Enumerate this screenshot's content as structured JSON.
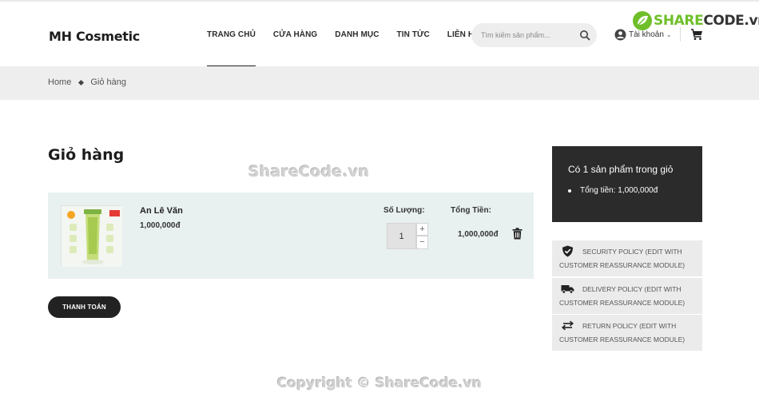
{
  "header": {
    "logo": "MH Cosmetic",
    "nav": [
      {
        "label": "TRANG CHỦ",
        "active": true
      },
      {
        "label": "CỬA HÀNG",
        "active": false
      },
      {
        "label": "DANH MỤC",
        "active": false
      },
      {
        "label": "TIN TỨC",
        "active": false
      },
      {
        "label": "LIÊN HỆ",
        "active": false
      }
    ],
    "search": {
      "placeholder": "Tìm kiếm sản phẩm..."
    },
    "account_label": "Tài khoản",
    "account_chevron": "⌄"
  },
  "watermark": {
    "brand_prefix": "SHARE",
    "brand_suffix": "CODE.vn",
    "center_text": "ShareCode.vn",
    "copyright": "Copyright © ShareCode.vn",
    "accent_color": "#6fbf2a"
  },
  "breadcrumb": {
    "items": [
      "Home",
      "Giỏ hàng"
    ]
  },
  "cart": {
    "title": "Giỏ hàng",
    "item": {
      "name": "An Lê Văn",
      "price": "1,000,000đ",
      "qty_label": "Số Lượng:",
      "qty": "1",
      "qty_up": "+",
      "qty_down": "−",
      "total_label": "Tổng Tiền:",
      "line_total": "1,000,000đ"
    },
    "checkout_label": "THANH TOÁN"
  },
  "summary": {
    "count_text": "Có 1 sản phẩm trong giỏ",
    "total_text": "Tổng tiền: 1,000,000đ"
  },
  "reassurance": [
    {
      "icon": "shield-check-icon",
      "line1": "SECURITY POLICY (EDIT WITH",
      "line2": "CUSTOMER REASSURANCE MODULE)"
    },
    {
      "icon": "truck-icon",
      "line1": "DELIVERY POLICY (EDIT WITH",
      "line2": "CUSTOMER REASSURANCE MODULE)"
    },
    {
      "icon": "return-arrows-icon",
      "line1": "RETURN POLICY (EDIT WITH",
      "line2": "CUSTOMER REASSURANCE MODULE)"
    }
  ],
  "colors": {
    "dark": "#222222",
    "cart_row_bg": "#e9f0f0",
    "breadcrumb_bg": "#eeeeee",
    "summary_bg": "#2b2b2b"
  }
}
